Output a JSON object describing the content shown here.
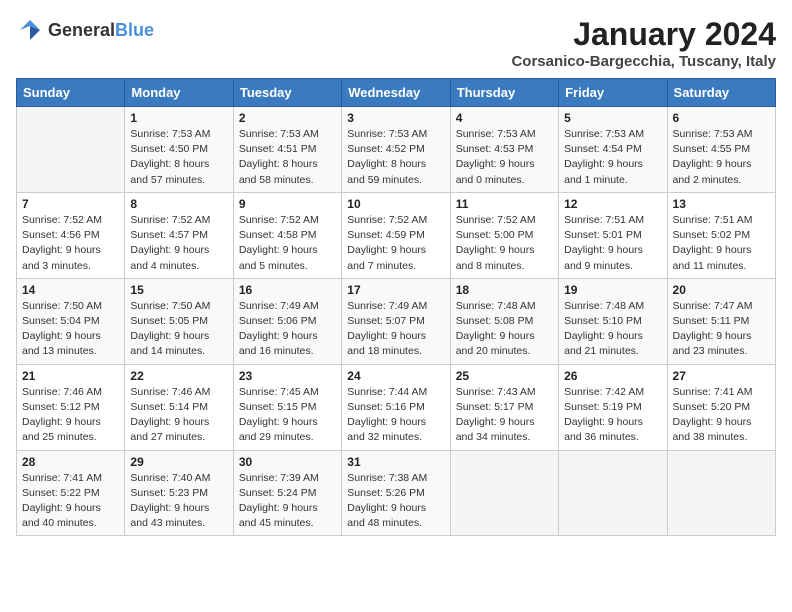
{
  "header": {
    "logo_general": "General",
    "logo_blue": "Blue",
    "month_year": "January 2024",
    "location": "Corsanico-Bargecchia, Tuscany, Italy"
  },
  "days_of_week": [
    "Sunday",
    "Monday",
    "Tuesday",
    "Wednesday",
    "Thursday",
    "Friday",
    "Saturday"
  ],
  "weeks": [
    [
      {
        "day": "",
        "info": ""
      },
      {
        "day": "1",
        "info": "Sunrise: 7:53 AM\nSunset: 4:50 PM\nDaylight: 8 hours\nand 57 minutes."
      },
      {
        "day": "2",
        "info": "Sunrise: 7:53 AM\nSunset: 4:51 PM\nDaylight: 8 hours\nand 58 minutes."
      },
      {
        "day": "3",
        "info": "Sunrise: 7:53 AM\nSunset: 4:52 PM\nDaylight: 8 hours\nand 59 minutes."
      },
      {
        "day": "4",
        "info": "Sunrise: 7:53 AM\nSunset: 4:53 PM\nDaylight: 9 hours\nand 0 minutes."
      },
      {
        "day": "5",
        "info": "Sunrise: 7:53 AM\nSunset: 4:54 PM\nDaylight: 9 hours\nand 1 minute."
      },
      {
        "day": "6",
        "info": "Sunrise: 7:53 AM\nSunset: 4:55 PM\nDaylight: 9 hours\nand 2 minutes."
      }
    ],
    [
      {
        "day": "7",
        "info": "Sunrise: 7:52 AM\nSunset: 4:56 PM\nDaylight: 9 hours\nand 3 minutes."
      },
      {
        "day": "8",
        "info": "Sunrise: 7:52 AM\nSunset: 4:57 PM\nDaylight: 9 hours\nand 4 minutes."
      },
      {
        "day": "9",
        "info": "Sunrise: 7:52 AM\nSunset: 4:58 PM\nDaylight: 9 hours\nand 5 minutes."
      },
      {
        "day": "10",
        "info": "Sunrise: 7:52 AM\nSunset: 4:59 PM\nDaylight: 9 hours\nand 7 minutes."
      },
      {
        "day": "11",
        "info": "Sunrise: 7:52 AM\nSunset: 5:00 PM\nDaylight: 9 hours\nand 8 minutes."
      },
      {
        "day": "12",
        "info": "Sunrise: 7:51 AM\nSunset: 5:01 PM\nDaylight: 9 hours\nand 9 minutes."
      },
      {
        "day": "13",
        "info": "Sunrise: 7:51 AM\nSunset: 5:02 PM\nDaylight: 9 hours\nand 11 minutes."
      }
    ],
    [
      {
        "day": "14",
        "info": "Sunrise: 7:50 AM\nSunset: 5:04 PM\nDaylight: 9 hours\nand 13 minutes."
      },
      {
        "day": "15",
        "info": "Sunrise: 7:50 AM\nSunset: 5:05 PM\nDaylight: 9 hours\nand 14 minutes."
      },
      {
        "day": "16",
        "info": "Sunrise: 7:49 AM\nSunset: 5:06 PM\nDaylight: 9 hours\nand 16 minutes."
      },
      {
        "day": "17",
        "info": "Sunrise: 7:49 AM\nSunset: 5:07 PM\nDaylight: 9 hours\nand 18 minutes."
      },
      {
        "day": "18",
        "info": "Sunrise: 7:48 AM\nSunset: 5:08 PM\nDaylight: 9 hours\nand 20 minutes."
      },
      {
        "day": "19",
        "info": "Sunrise: 7:48 AM\nSunset: 5:10 PM\nDaylight: 9 hours\nand 21 minutes."
      },
      {
        "day": "20",
        "info": "Sunrise: 7:47 AM\nSunset: 5:11 PM\nDaylight: 9 hours\nand 23 minutes."
      }
    ],
    [
      {
        "day": "21",
        "info": "Sunrise: 7:46 AM\nSunset: 5:12 PM\nDaylight: 9 hours\nand 25 minutes."
      },
      {
        "day": "22",
        "info": "Sunrise: 7:46 AM\nSunset: 5:14 PM\nDaylight: 9 hours\nand 27 minutes."
      },
      {
        "day": "23",
        "info": "Sunrise: 7:45 AM\nSunset: 5:15 PM\nDaylight: 9 hours\nand 29 minutes."
      },
      {
        "day": "24",
        "info": "Sunrise: 7:44 AM\nSunset: 5:16 PM\nDaylight: 9 hours\nand 32 minutes."
      },
      {
        "day": "25",
        "info": "Sunrise: 7:43 AM\nSunset: 5:17 PM\nDaylight: 9 hours\nand 34 minutes."
      },
      {
        "day": "26",
        "info": "Sunrise: 7:42 AM\nSunset: 5:19 PM\nDaylight: 9 hours\nand 36 minutes."
      },
      {
        "day": "27",
        "info": "Sunrise: 7:41 AM\nSunset: 5:20 PM\nDaylight: 9 hours\nand 38 minutes."
      }
    ],
    [
      {
        "day": "28",
        "info": "Sunrise: 7:41 AM\nSunset: 5:22 PM\nDaylight: 9 hours\nand 40 minutes."
      },
      {
        "day": "29",
        "info": "Sunrise: 7:40 AM\nSunset: 5:23 PM\nDaylight: 9 hours\nand 43 minutes."
      },
      {
        "day": "30",
        "info": "Sunrise: 7:39 AM\nSunset: 5:24 PM\nDaylight: 9 hours\nand 45 minutes."
      },
      {
        "day": "31",
        "info": "Sunrise: 7:38 AM\nSunset: 5:26 PM\nDaylight: 9 hours\nand 48 minutes."
      },
      {
        "day": "",
        "info": ""
      },
      {
        "day": "",
        "info": ""
      },
      {
        "day": "",
        "info": ""
      }
    ]
  ]
}
